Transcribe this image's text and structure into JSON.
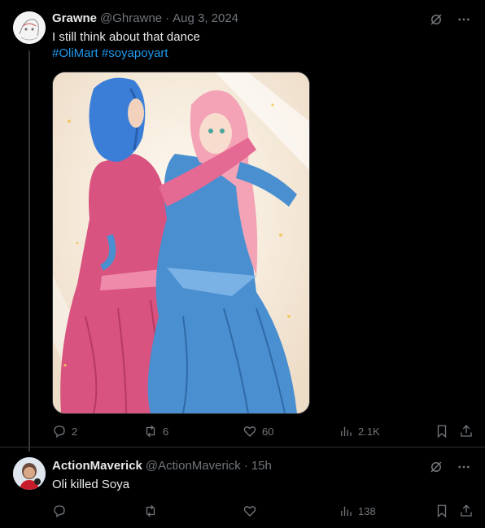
{
  "tweet1": {
    "display_name": "Grawne",
    "handle": "@Ghrawne",
    "date": "Aug 3, 2024",
    "text": "I still think about that dance",
    "hashtags": [
      "#OliMart",
      "#soyapoyart"
    ],
    "stats": {
      "replies": "2",
      "reposts": "6",
      "likes": "60",
      "views": "2.1K"
    },
    "avatar_icon": "sketch-avatar-icon"
  },
  "tweet2": {
    "display_name": "ActionMaverick",
    "handle": "@ActionMaverick",
    "time": "15h",
    "text": "Oli killed Soya",
    "stats": {
      "replies": "",
      "reposts": "",
      "likes": "",
      "views": "138"
    },
    "avatar_icon": "character-avatar-icon"
  },
  "colors": {
    "background": "#000000",
    "text": "#e7e9ea",
    "muted": "#71767b",
    "link": "#1d9bf0",
    "border": "#2f3336"
  },
  "icons": [
    "grok-icon",
    "more-icon",
    "reply-icon",
    "repost-icon",
    "like-icon",
    "views-icon",
    "bookmark-icon",
    "share-icon"
  ]
}
